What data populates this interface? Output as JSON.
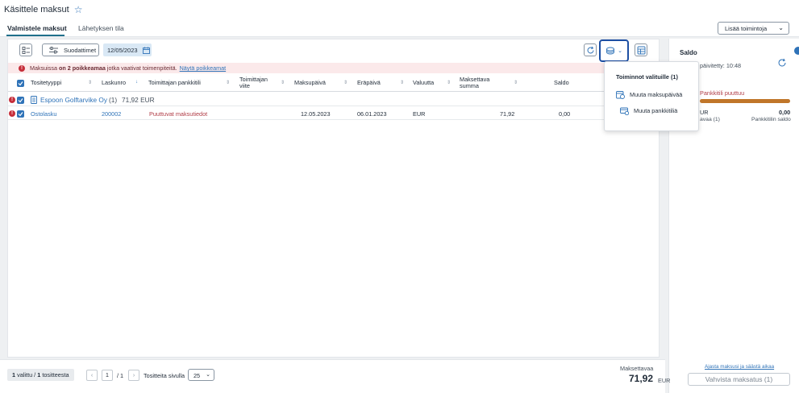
{
  "page": {
    "title": "Käsittele maksut"
  },
  "tabs": [
    {
      "label": "Valmistele maksut",
      "active": true
    },
    {
      "label": "Lähetyksen tila",
      "active": false
    }
  ],
  "header_actions": {
    "add_actions_label": "Lisää toimintoja"
  },
  "toolbar": {
    "filters_label": "Suodattimet",
    "date_value": "12/05/2023"
  },
  "alert": {
    "prefix": "Maksuissa",
    "bold": "on 2 poikkeamaa",
    "suffix": "jotka vaativat toimenpiteitä.",
    "link": "Näytä poikkeamat"
  },
  "table": {
    "columns": {
      "tositetyyppi": "Tositetyyppi",
      "laskunro": "Laskunro",
      "pankkitili": "Toimittajan pankkitili",
      "viite_line1": "Toimittajan",
      "viite_line2": "viite",
      "maksupaiva": "Maksupäivä",
      "erapaiva": "Eräpäivä",
      "valuutta": "Valuutta",
      "summa_line1": "Maksettava",
      "summa_line2": "summa",
      "saldo": "Saldo"
    },
    "group": {
      "name": "Espoon Golftarvike Oy",
      "count": "(1)",
      "amount": "71,92 EUR"
    },
    "rows": [
      {
        "tositetyyppi": "Ostolasku",
        "laskunro": "200002",
        "pankkitili": "Puuttuvat maksutiedot",
        "maksupaiva": "12.05.2023",
        "erapaiva": "06.01.2023",
        "valuutta": "EUR",
        "summa": "71,92",
        "saldo": "0,00"
      }
    ]
  },
  "popup": {
    "title": "Toiminnot valituille (1)",
    "items": [
      {
        "label": "Muuta maksupäivää"
      },
      {
        "label": "Muuta pankkitiliä"
      }
    ]
  },
  "saldo_panel": {
    "title": "Saldo",
    "updated": "päivitetty: 10:48",
    "warning": "Pankkitili puuttuu",
    "currency_partial": "UR",
    "amount": "0,00",
    "left_caption": "avaa (1)",
    "right_caption": "Pankkitilin saldo",
    "bar_fill": 1.0
  },
  "footer": {
    "selected_count": "1",
    "selected_mid": "valittu /",
    "total_count": "1",
    "total_suffix": "tositteesta",
    "page_current": "1",
    "page_total": "/ 1",
    "per_page_label": "Tositteita sivulla",
    "per_page_value": "25",
    "payable_label": "Maksettavaa",
    "payable_amount": "71,92",
    "payable_currency": "EUR",
    "schedule_link": "Ajasta maksusi ja säästä aikaa",
    "confirm_label": "Vahvista maksatus (1)"
  },
  "colors": {
    "accent": "#2f73b8",
    "error": "#c62e3a",
    "warning_bar": "#c0762a",
    "highlight_border": "#1d4fa3"
  }
}
